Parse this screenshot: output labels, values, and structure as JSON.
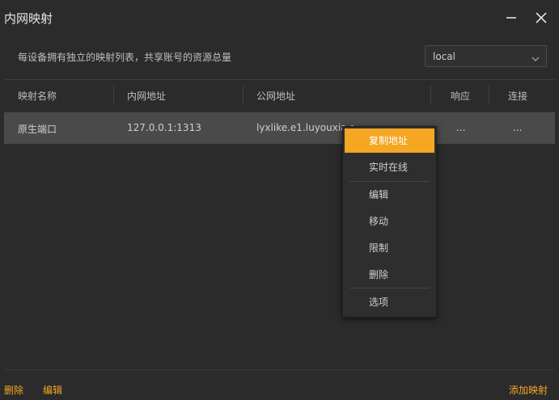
{
  "window": {
    "title": "内网映射"
  },
  "description": "每设备拥有独立的映射列表，共享账号的资源总量",
  "selector": {
    "value": "local"
  },
  "table": {
    "columns": [
      "映射名称",
      "内网地址",
      "公网地址",
      "响应",
      "连接"
    ],
    "rows": [
      {
        "name": "原生端口",
        "local": "127.0.0.1:1313",
        "public": "lyxlike.e1.luyouxia.net:13461",
        "response": "...",
        "connections": "..."
      }
    ]
  },
  "context_menu": {
    "items": [
      "复制地址",
      "实时在线",
      "编辑",
      "移动",
      "限制",
      "删除",
      "选项"
    ]
  },
  "footer": {
    "delete": "删除",
    "edit": "编辑",
    "add": "添加映射"
  },
  "colors": {
    "accent": "#f5a623",
    "background": "#2b2b2b",
    "row_selected": "#4a4a4a"
  }
}
